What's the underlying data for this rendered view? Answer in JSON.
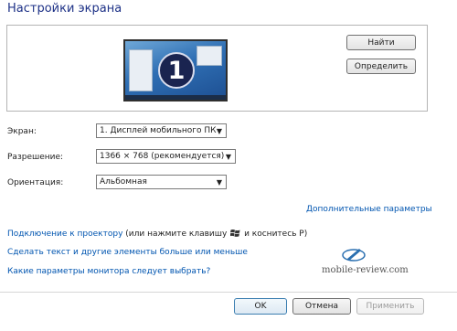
{
  "window": {
    "title": "Настройки экрана"
  },
  "preview": {
    "monitor_number": "1",
    "find_label": "Найти",
    "identify_label": "Определить"
  },
  "settings": {
    "screen_label": "Экран:",
    "screen_value": "1. Дисплей мобильного ПК",
    "resolution_label": "Разрешение:",
    "resolution_value": "1366 × 768 (рекомендуется)",
    "orientation_label": "Ориентация:",
    "orientation_value": "Альбомная"
  },
  "links": {
    "advanced": "Дополнительные параметры",
    "projector_link": "Подключение к проектору",
    "projector_hint_pre": "(или нажмите клавишу",
    "projector_hint_post": "и коснитесь P)",
    "text_size": "Сделать текст и другие элементы больше или меньше",
    "which_settings": "Какие параметры монитора следует выбрать?"
  },
  "watermark": {
    "text": "mobile-review.com"
  },
  "footer": {
    "ok_label": "OK",
    "cancel_label": "Отмена",
    "apply_label": "Применить"
  },
  "icons": {
    "dropdown": "chevron-down-icon",
    "windows_key": "windows-logo-icon",
    "watermark": "pen-logo-icon"
  },
  "colors": {
    "title": "#1e3287",
    "link": "#0055b0",
    "monitor_bg": "#2f6fb4"
  }
}
